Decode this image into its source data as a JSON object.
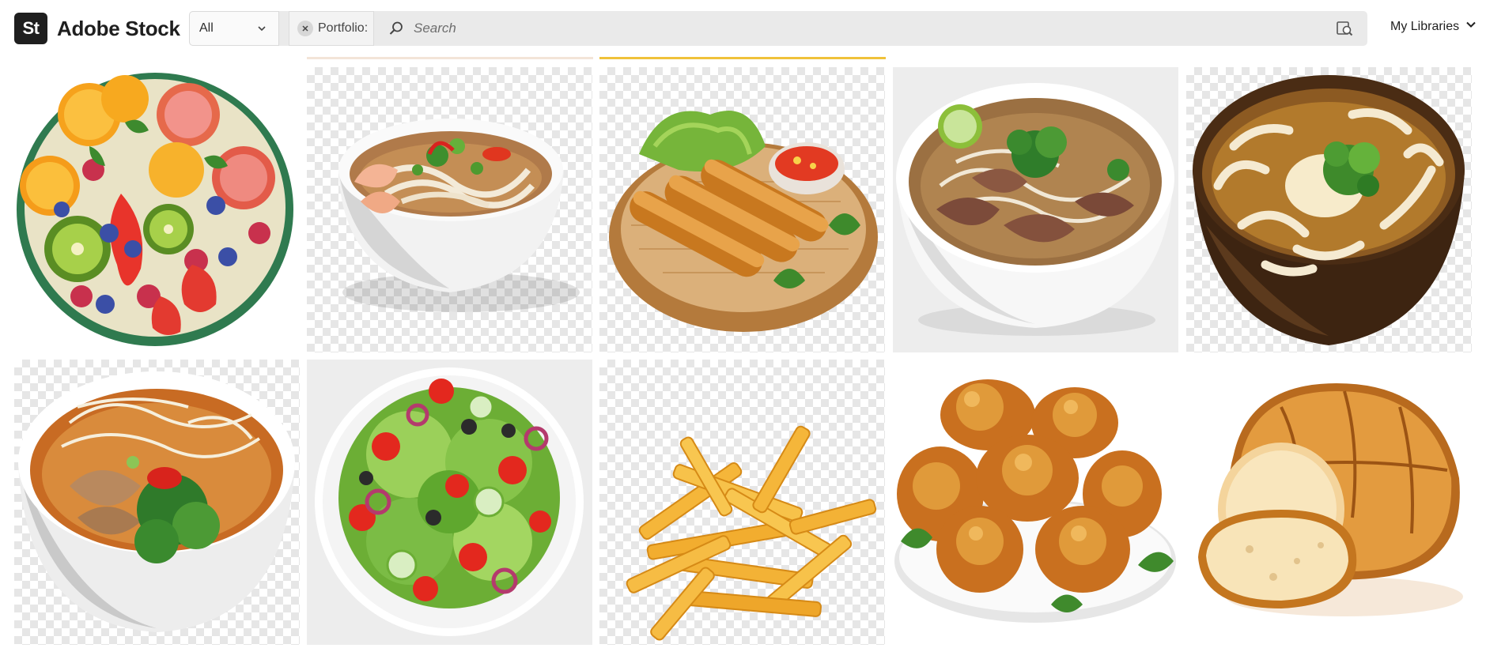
{
  "app": {
    "brand_mark": "St",
    "brand_name": "Adobe Stock"
  },
  "search": {
    "filter_value": "All",
    "chip_label": "Portfolio:",
    "placeholder": "Search"
  },
  "nav": {
    "my_libraries": "My Libraries"
  },
  "icons": {
    "clear_chip": "close-icon",
    "search": "search-icon",
    "visual_search": "visual-search-icon",
    "dropdown": "chevron-down-icon"
  },
  "colors": {
    "brand_dark": "#1f1f1f",
    "search_bg": "#eaeaea"
  },
  "results": [
    {
      "subject": "fruit platter",
      "background": "white"
    },
    {
      "subject": "shrimp noodle soup bowl",
      "background": "transparent"
    },
    {
      "subject": "spring rolls on bamboo tray",
      "background": "transparent"
    },
    {
      "subject": "beef pho bowl with lime",
      "background": "grey"
    },
    {
      "subject": "udon noodle bowl",
      "background": "transparent"
    },
    {
      "subject": "chicken noodle soup bowl",
      "background": "transparent"
    },
    {
      "subject": "green salad plate",
      "background": "grey"
    },
    {
      "subject": "french fries",
      "background": "transparent"
    },
    {
      "subject": "fried chicken plate",
      "background": "white"
    },
    {
      "subject": "bread loaf",
      "background": "white"
    }
  ]
}
